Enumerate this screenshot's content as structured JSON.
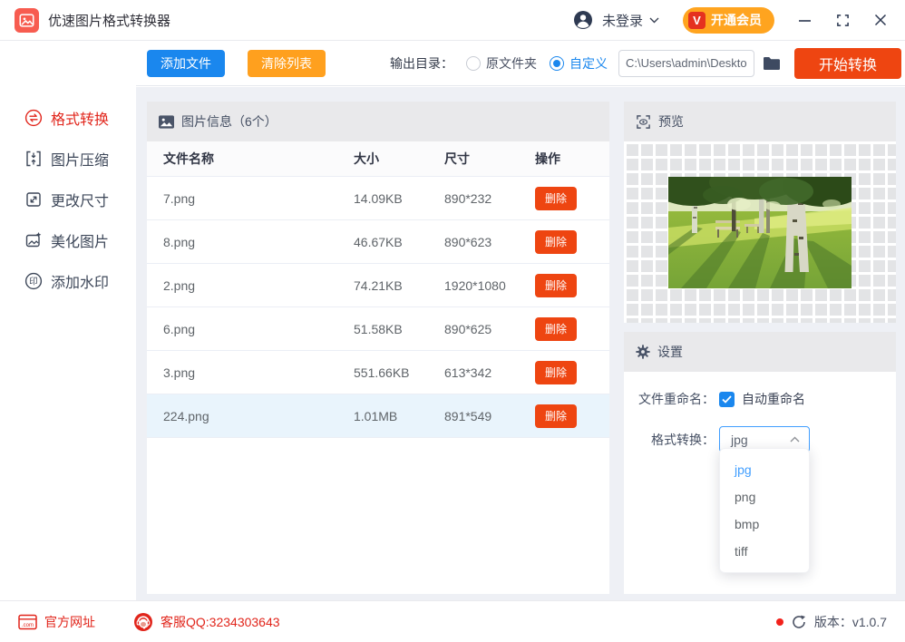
{
  "titlebar": {
    "app_title": "优速图片格式转换器",
    "login_label": "未登录",
    "vip_label": "开通会员",
    "vip_badge_glyph": "V"
  },
  "sidebar": {
    "items": [
      {
        "label": "格式转换",
        "icon": "format-convert-icon",
        "active": true
      },
      {
        "label": "图片压缩",
        "icon": "compress-icon",
        "active": false
      },
      {
        "label": "更改尺寸",
        "icon": "resize-icon",
        "active": false
      },
      {
        "label": "美化图片",
        "icon": "beautify-icon",
        "active": false
      },
      {
        "label": "添加水印",
        "icon": "watermark-icon",
        "active": false
      }
    ],
    "watermark_glyph": "印"
  },
  "toolbar": {
    "add_files_label": "添加文件",
    "clear_list_label": "清除列表",
    "output_dir_label": "输出目录：",
    "radio_original_label": "原文件夹",
    "radio_custom_label": "自定义",
    "radio_selected": "自定义",
    "output_path_value": "C:\\Users\\admin\\Deskto",
    "start_label": "开始转换"
  },
  "file_table": {
    "section_title": "图片信息（6个）",
    "columns": [
      "文件名称",
      "大小",
      "尺寸",
      "操作"
    ],
    "delete_label": "删除",
    "rows": [
      {
        "name": "7.png",
        "size": "14.09KB",
        "dims": "890*232",
        "selected": false
      },
      {
        "name": "8.png",
        "size": "46.67KB",
        "dims": "890*623",
        "selected": false
      },
      {
        "name": "2.png",
        "size": "74.21KB",
        "dims": "1920*1080",
        "selected": false
      },
      {
        "name": "6.png",
        "size": "51.58KB",
        "dims": "890*625",
        "selected": false
      },
      {
        "name": "3.png",
        "size": "551.66KB",
        "dims": "613*342",
        "selected": false
      },
      {
        "name": "224.png",
        "size": "1.01MB",
        "dims": "891*549",
        "selected": true
      }
    ]
  },
  "preview": {
    "section_title": "预览"
  },
  "settings": {
    "section_title": "设置",
    "rename_label": "文件重命名：",
    "rename_checkbox_label": "自动重命名",
    "rename_checked": true,
    "format_label": "格式转换：",
    "format_value": "jpg",
    "format_options": [
      "jpg",
      "png",
      "bmp",
      "tiff"
    ]
  },
  "footer": {
    "website_label": "官方网址",
    "website_icon_glyph": ".com",
    "qq_label": "客服QQ:3234303643",
    "version_label": "版本：v1.0.7"
  },
  "colors": {
    "accent_red": "#e1251b",
    "accent_blue": "#1a87ee",
    "accent_orange": "#ffa01e",
    "action_red": "#ee4511",
    "dropdown_blue": "#409eff",
    "selected_row": "#e9f4fc",
    "section_header_bg": "#e9e9eb",
    "content_bg": "#eef0f5"
  }
}
